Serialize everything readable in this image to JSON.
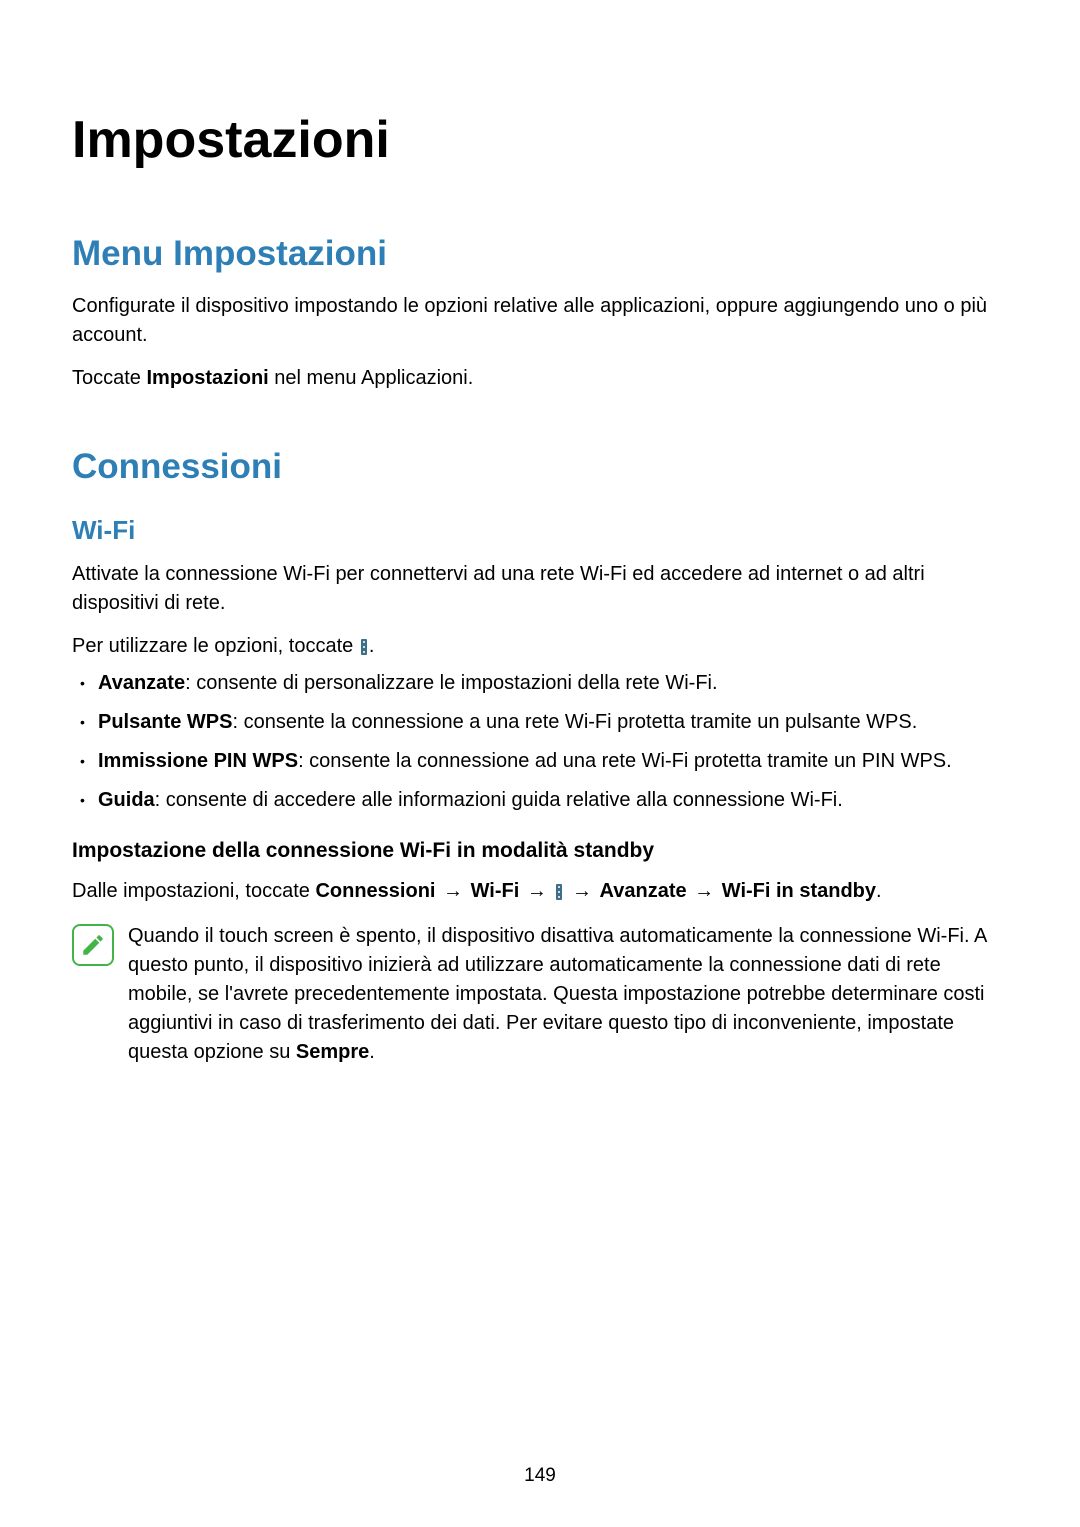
{
  "main_title": "Impostazioni",
  "section1": {
    "title": "Menu Impostazioni",
    "p1": "Configurate il dispositivo impostando le opzioni relative alle applicazioni, oppure aggiungendo uno o più account.",
    "p2_pre": "Toccate ",
    "p2_bold": "Impostazioni",
    "p2_post": " nel menu Applicazioni."
  },
  "section2": {
    "title": "Connessioni",
    "sub1": {
      "heading": "Wi-Fi",
      "p1": "Attivate la connessione Wi-Fi per connettervi ad una rete Wi-Fi ed accedere ad internet o ad altri dispositivi di rete.",
      "p2_pre": "Per utilizzare le opzioni, toccate ",
      "p2_post": ".",
      "bullets": [
        {
          "bold": "Avanzate",
          "rest": ": consente di personalizzare le impostazioni della rete Wi-Fi."
        },
        {
          "bold": "Pulsante WPS",
          "rest": ": consente la connessione a una rete Wi-Fi protetta tramite un pulsante WPS."
        },
        {
          "bold": "Immissione PIN WPS",
          "rest": ": consente la connessione ad una rete Wi-Fi protetta tramite un PIN WPS."
        },
        {
          "bold": "Guida",
          "rest": ": consente di accedere alle informazioni guida relative alla connessione Wi-Fi."
        }
      ],
      "subsub": {
        "heading": "Impostazione della connessione Wi-Fi in modalità standby",
        "p1_pre": "Dalle impostazioni, toccate ",
        "p1_b1": "Connessioni",
        "p1_arr1": " → ",
        "p1_b2": "Wi-Fi",
        "p1_arr2": " → ",
        "p1_arr3": " → ",
        "p1_b3": "Avanzate",
        "p1_arr4": " → ",
        "p1_b4": "Wi-Fi in standby",
        "p1_post": "."
      },
      "note": {
        "t1": "Quando il touch screen è spento, il dispositivo disattiva automaticamente la connessione Wi-Fi. A questo punto, il dispositivo inizierà ad utilizzare automaticamente la connessione dati di rete mobile, se l'avrete precedentemente impostata. Questa impostazione potrebbe determinare costi aggiuntivi in caso di trasferimento dei dati. Per evitare questo tipo di inconveniente, impostate questa opzione su ",
        "t_bold": "Sempre",
        "t2": "."
      }
    }
  },
  "page_number": "149"
}
